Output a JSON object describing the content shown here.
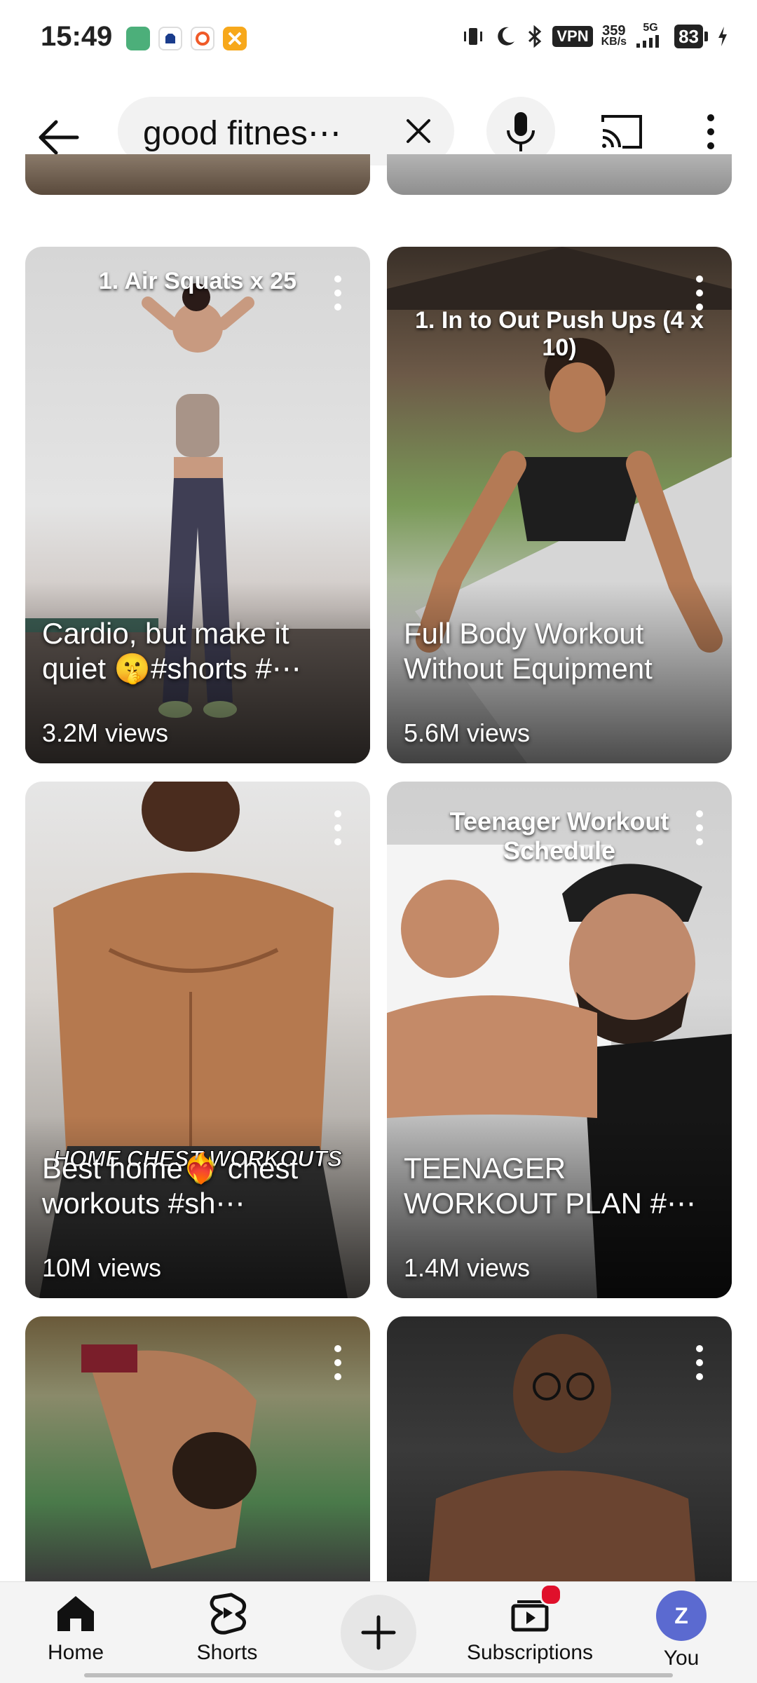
{
  "status_bar": {
    "time": "15:49",
    "vpn": "VPN",
    "speed_value": "359",
    "speed_unit": "KB/s",
    "network": "5G",
    "battery": "83"
  },
  "search": {
    "query": "good fitnes⋯"
  },
  "cards": [
    {
      "overlay": "1. Air Squats x 25",
      "title": "Cardio, but make it quiet 🤫#shorts #⋯",
      "views": "3.2M views"
    },
    {
      "overlay": "1. In to Out Push Ups (4 x 10)",
      "title": "Full Body Workout Without Equipment",
      "views": "5.6M views"
    },
    {
      "overlay": "HOME CHEST WORKOUTS",
      "title": "Best home❤️‍🔥 chest workouts #sh⋯",
      "views": "10M views"
    },
    {
      "overlay": "Teenager Workout Schedule",
      "title": "TEENAGER WORKOUT PLAN #⋯",
      "views": "1.4M views"
    }
  ],
  "nav": {
    "home": "Home",
    "shorts": "Shorts",
    "subscriptions": "Subscriptions",
    "you": "You",
    "avatar_letter": "Z"
  },
  "colors": {
    "avatar_bg": "#5b6ad0",
    "notification_dot": "#e0102b"
  }
}
